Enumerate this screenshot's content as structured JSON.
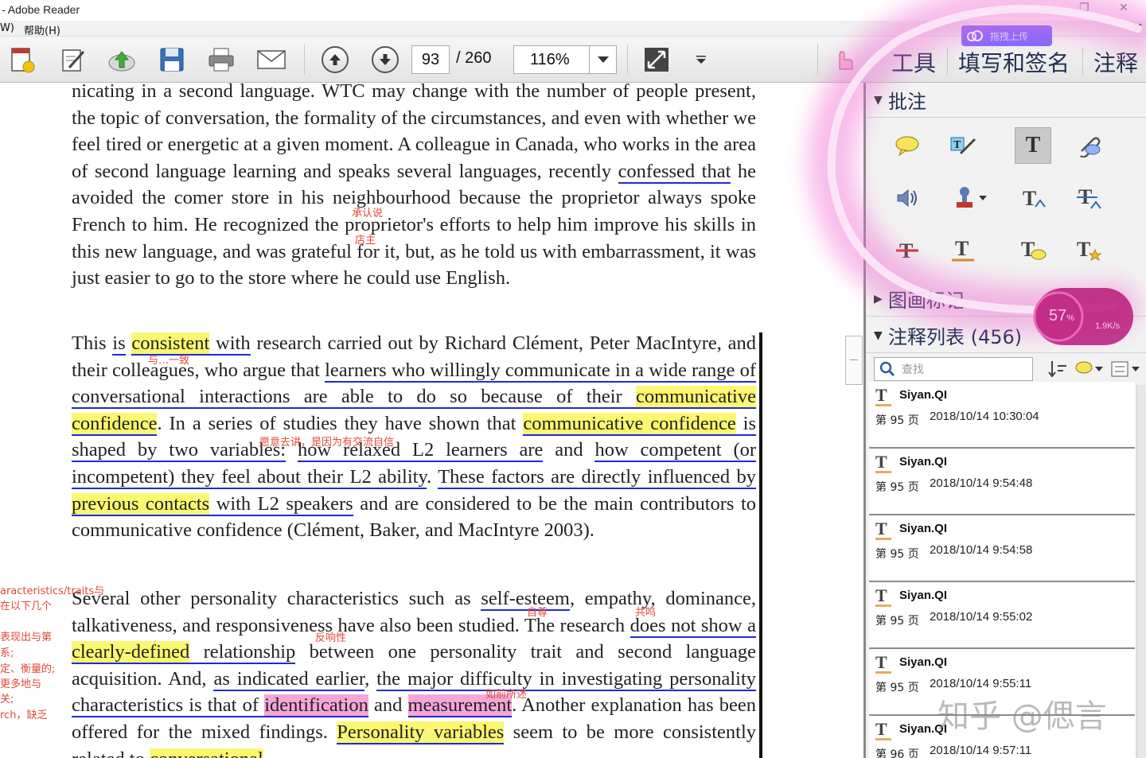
{
  "window": {
    "title": "- Adobe Reader",
    "minimize": "–",
    "maximize": "❐",
    "close": "✕"
  },
  "menu": {
    "items": [
      "W)",
      "帮助(H)"
    ],
    "close_doc": "✖"
  },
  "toolbar": {
    "page_current": "93",
    "page_total": "/ 260",
    "zoom": "116%",
    "tabs": [
      "工具",
      "填写和签名",
      "注释"
    ],
    "upload_badge": "拖拽上传"
  },
  "document": {
    "para1": [
      {
        "t": "nicating in a second language. WTC may change with the number of people present, the topic of conversation, the formality of the circumstances, and even with whether we feel tired or energetic at a given moment. A colleague in Canada, who works in the area of second language learning and speaks several languages, recently "
      },
      {
        "t": "confessed that",
        "c": "ul"
      },
      {
        "t": " he avoided the comer store in his neighbourhood because the proprietor always spoke French to him. He recognized the proprietor's efforts to help him improve his skills in this new language, and was grateful for it, but, as he told us with embarrassment, it was just easier to go to the store where he could use English."
      }
    ],
    "para2": [
      {
        "t": "This "
      },
      {
        "t": "is",
        "c": "ul"
      },
      {
        "t": " "
      },
      {
        "t": "consistent",
        "c": "ul hl"
      },
      {
        "t": " with",
        "c": "ul"
      },
      {
        "t": " research carried out by Richard Clément, Peter MacIntyre, and their colleagues, who argue that "
      },
      {
        "t": "learners who willingly communicate in a wide range of conversational interactions are able to do so because of their ",
        "c": "ul"
      },
      {
        "t": "communicative confidence",
        "c": "ul hl"
      },
      {
        "t": ". In a series of studies they have shown that "
      },
      {
        "t": "communicative confidence",
        "c": "ul hl"
      },
      {
        "t": " is shaped by two variables:",
        "c": "ul"
      },
      {
        "t": " "
      },
      {
        "t": "how relaxed L2 learners are",
        "c": "ul"
      },
      {
        "t": " and "
      },
      {
        "t": "how competent (or incompetent) they feel about their L2 ability",
        "c": "ul"
      },
      {
        "t": ". "
      },
      {
        "t": "These factors are directly influenced by ",
        "c": "ul"
      },
      {
        "t": "previous contacts",
        "c": "ul hl"
      },
      {
        "t": " with L2 speakers",
        "c": "ul"
      },
      {
        "t": " and are considered to be the main contributors to communicative confidence (Clément, Baker, and MacIntyre 2003)."
      }
    ],
    "para3": [
      {
        "t": "Several other personality characteristics such as "
      },
      {
        "t": "self-esteem",
        "c": "ul"
      },
      {
        "t": ", empathy, dominance, talkativeness, and responsiveness have also been studied. The research "
      },
      {
        "t": "does not show a ",
        "c": "ul"
      },
      {
        "t": "clearly-defined",
        "c": "ul hl"
      },
      {
        "t": " relationship",
        "c": "ul"
      },
      {
        "t": " between one personality trait and second language acquisition. And, "
      },
      {
        "t": "as indicated earlier",
        "c": "ul"
      },
      {
        "t": ", "
      },
      {
        "t": "the major difficulty in investigating personality characteristics is that of ",
        "c": "ul"
      },
      {
        "t": "identification",
        "c": "ul hlp"
      },
      {
        "t": " and "
      },
      {
        "t": "measurement",
        "c": "ul hlp"
      },
      {
        "t": ". Another explanation has been offered for the mixed findings. "
      },
      {
        "t": "Personality variables",
        "c": "ul hl"
      },
      {
        "t": " seem to be more consistently related to "
      },
      {
        "t": "conversational",
        "c": "ul hl"
      }
    ],
    "notes": {
      "n1": "承认说",
      "n2": "店主",
      "n3": "与…一致",
      "n4": "愿意去讲，是因为有交流自信",
      "n5": "自尊",
      "n6": "共鸣",
      "n7": "反响性",
      "n8": "如前所述"
    },
    "margin_notes": [
      "aracteristics/traits与",
      "在以下几个",
      "表现出与第",
      "系;",
      "定、衡量的;",
      "更多地与",
      "关;",
      "rch，缺乏"
    ]
  },
  "panel": {
    "section_annotate": "批注",
    "section_drawing": "图画标记",
    "section_list": "注释列表 (456)",
    "search_placeholder": "查找",
    "comments": [
      {
        "author": "Siyan.QI",
        "page": "第 95 页",
        "time": "2018/10/14 10:30:04"
      },
      {
        "author": "Siyan.QI",
        "page": "第 95 页",
        "time": "2018/10/14 9:54:48"
      },
      {
        "author": "Siyan.QI",
        "page": "第 95 页",
        "time": "2018/10/14 9:54:58"
      },
      {
        "author": "Siyan.QI",
        "page": "第 95 页",
        "time": "2018/10/14 9:55:02"
      },
      {
        "author": "Siyan.QI",
        "page": "第 95 页",
        "time": "2018/10/14 9:55:11"
      },
      {
        "author": "Siyan.QI",
        "page": "第 96 页",
        "time": "2018/10/14 9:57:11"
      }
    ],
    "speed": {
      "percent": "57",
      "unit": "%",
      "rate": "1.9K/s"
    }
  },
  "watermark": "知乎 @偲言",
  "colors": {
    "underline": "#1c2bd6",
    "highlight": "#fbf770",
    "pink_highlight": "#f6a6d6",
    "note_red": "#e04a3a",
    "tab_blue": "#1f2f55"
  }
}
